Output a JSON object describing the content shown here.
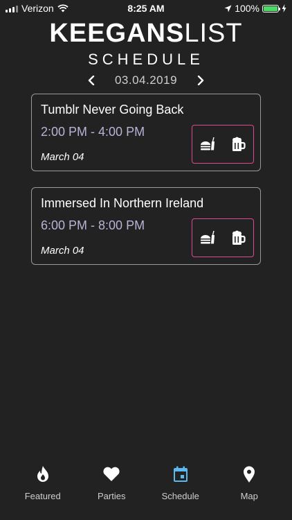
{
  "status_bar": {
    "carrier": "Verizon",
    "time": "8:25 AM",
    "battery": "100%"
  },
  "header": {
    "logo_bold": "KEEGANS",
    "logo_light": "LIST",
    "subtitle": "SCHEDULE",
    "date": "03.04.2019"
  },
  "events": [
    {
      "title": "Tumblr Never Going Back",
      "time": "2:00 PM - 4:00 PM",
      "date": "March 04"
    },
    {
      "title": "Immersed In Northern Ireland",
      "time": "6:00 PM - 8:00 PM",
      "date": "March 04"
    }
  ],
  "tabs": [
    {
      "label": "Featured",
      "icon": "flame-icon"
    },
    {
      "label": "Parties",
      "icon": "heart-icon"
    },
    {
      "label": "Schedule",
      "icon": "calendar-icon",
      "active": true
    },
    {
      "label": "Map",
      "icon": "map-pin-icon"
    }
  ],
  "colors": {
    "background": "#222222",
    "card_border": "#9a9a9a",
    "amenity_border": "#e0489a",
    "time_text": "#b9b3d6",
    "active_tab": "#5bb8f0",
    "battery": "#4cd964"
  }
}
